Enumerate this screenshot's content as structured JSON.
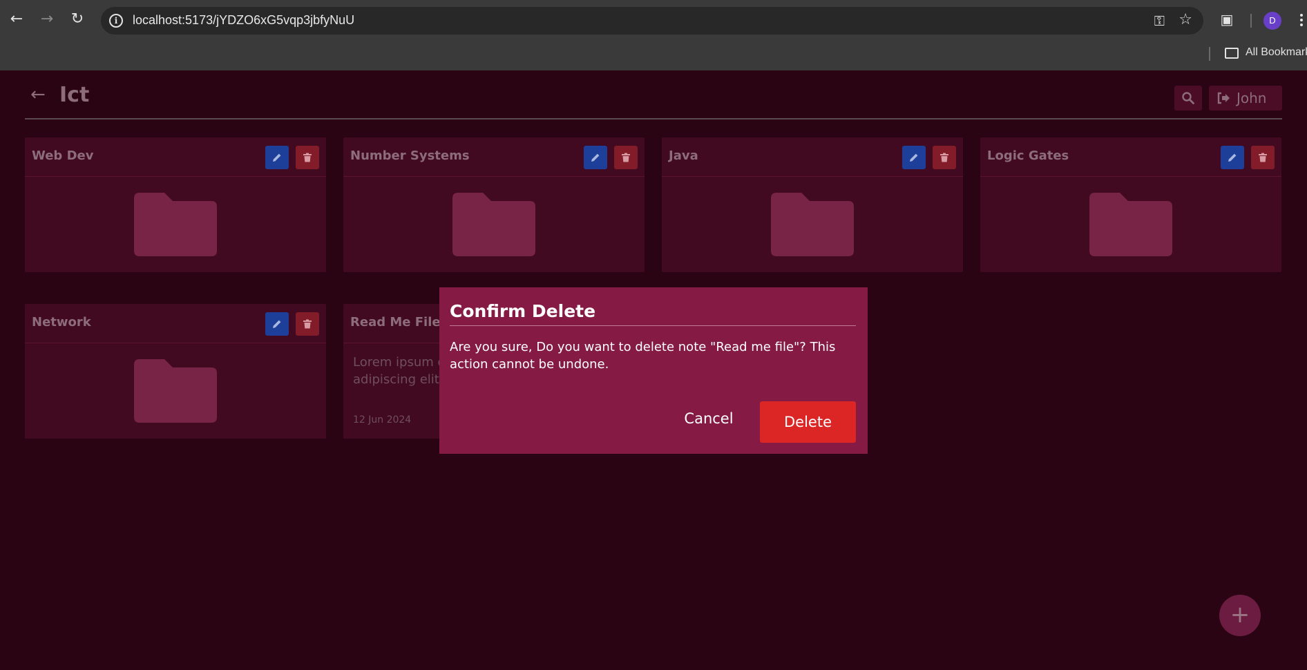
{
  "browser": {
    "url": "localhost:5173/jYDZO6xG5vqp3jbfyNuU",
    "profile_initial": "D",
    "bookmarks_label": "All Bookmarks"
  },
  "header": {
    "title": "Ict",
    "user_name": "John"
  },
  "folders": [
    {
      "name": "Web Dev"
    },
    {
      "name": "Number Systems"
    },
    {
      "name": "Java"
    },
    {
      "name": "Logic Gates"
    },
    {
      "name": "Network"
    }
  ],
  "note": {
    "title": "Read Me File",
    "preview": "Lorem ipsum dolor sit amet, consectetur adipiscing elit.",
    "date": "12 Jun 2024"
  },
  "modal": {
    "title": "Confirm Delete",
    "message": "Are you sure, Do you want to delete note \"Read me file\"? This action cannot be undone.",
    "cancel_label": "Cancel",
    "delete_label": "Delete"
  },
  "fab": {
    "label": "+"
  },
  "colors": {
    "background": "#2a0413",
    "card": "#420a20",
    "modal": "#851a45",
    "danger": "#dc2626",
    "edit": "#1e3f99"
  }
}
